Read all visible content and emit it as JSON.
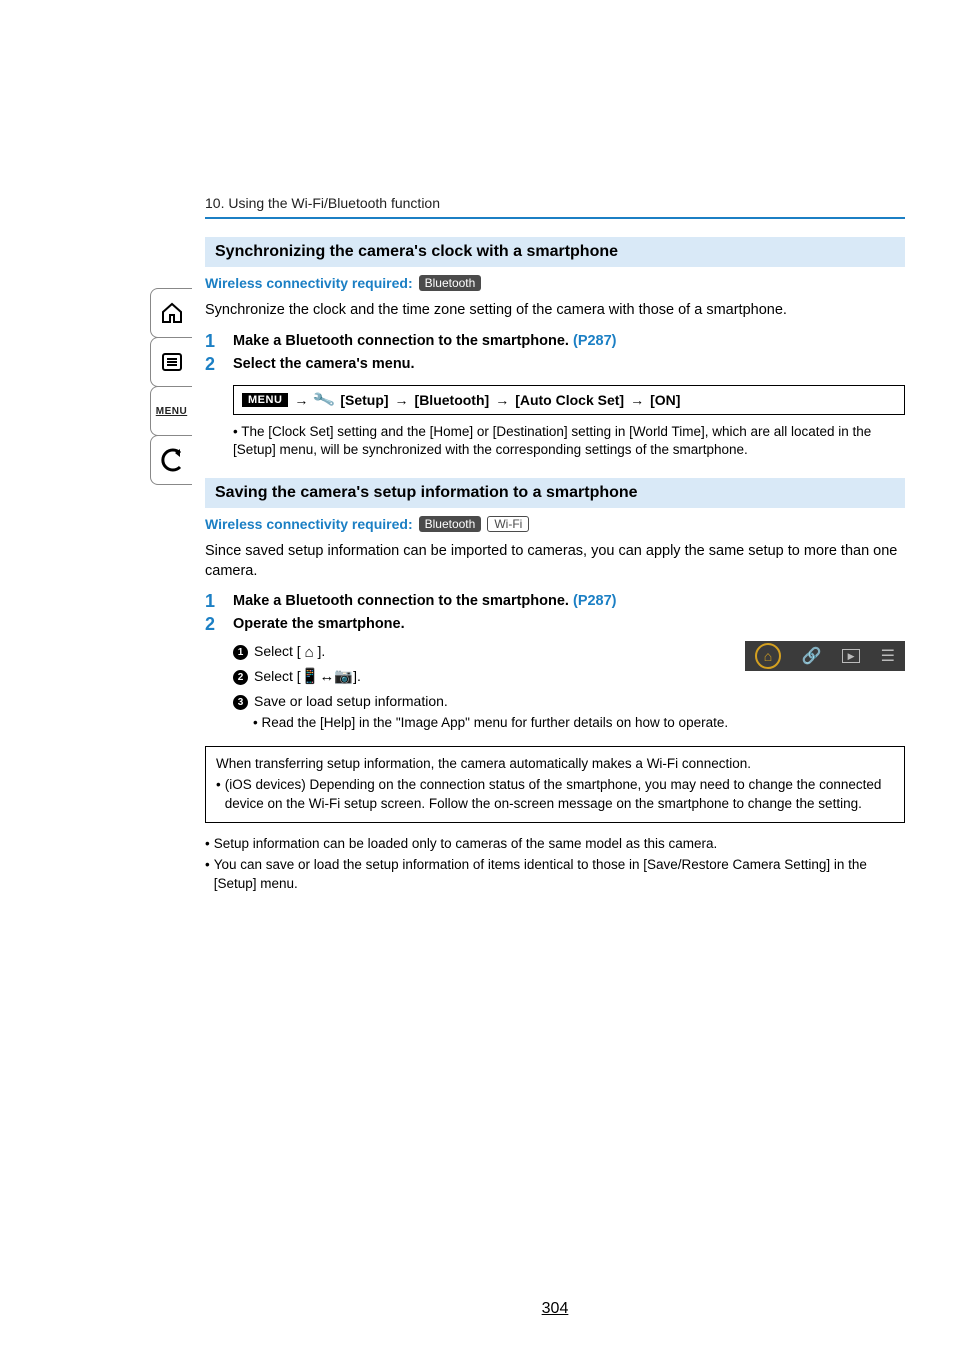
{
  "chapter": "10. Using the Wi-Fi/Bluetooth function",
  "section1": {
    "title": "Synchronizing the camera's clock with a smartphone",
    "wireless_label": "Wireless connectivity required:",
    "badge": "Bluetooth",
    "intro": "Synchronize the clock and the time zone setting of the camera with those of a smartphone.",
    "step1_pre": "Make a Bluetooth connection to the smartphone. ",
    "step1_link": "(P287)",
    "step2": "Select the camera's menu.",
    "menu_path_setup": "[Setup]",
    "menu_path_bt": "[Bluetooth]",
    "menu_path_acs": "[Auto Clock Set]",
    "menu_path_on": "[ON]",
    "bullet": "The [Clock Set] setting and the [Home] or [Destination] setting in [World Time], which are all located in the [Setup] menu, will be synchronized with the corresponding settings of the smartphone."
  },
  "section2": {
    "title": "Saving the camera's setup information to a smartphone",
    "wireless_label": "Wireless connectivity required:",
    "badge1": "Bluetooth",
    "badge2": "Wi-Fi",
    "intro": "Since saved setup information can be imported to cameras, you can apply the same setup to more than one camera.",
    "step1_pre": "Make a Bluetooth connection to the smartphone. ",
    "step1_link": "(P287)",
    "step2": "Operate the smartphone.",
    "sub1_pre": "Select [",
    "sub1_post": "].",
    "sub2_pre": "Select [",
    "sub2_post": "].",
    "sub3": "Save or load setup information.",
    "sub3_bullet": "Read the [Help] in the \"Image App\" menu for further details on how to operate.",
    "note_l1": "When transferring setup information, the camera automatically makes a Wi-Fi connection.",
    "note_l2": "(iOS devices) Depending on the connection status of the smartphone, you may need to change the connected device on the Wi-Fi setup screen. Follow the on-screen message on the smartphone to change the setting.",
    "foot1": "Setup information can be loaded only to cameras of the same model as this camera.",
    "foot2": "You can save or load the setup information of items identical to those in [Save/Restore Camera Setting] in the [Setup] menu."
  },
  "page_number": "304",
  "sidebar": {
    "menu": "MENU"
  },
  "menu_label": "MENU"
}
